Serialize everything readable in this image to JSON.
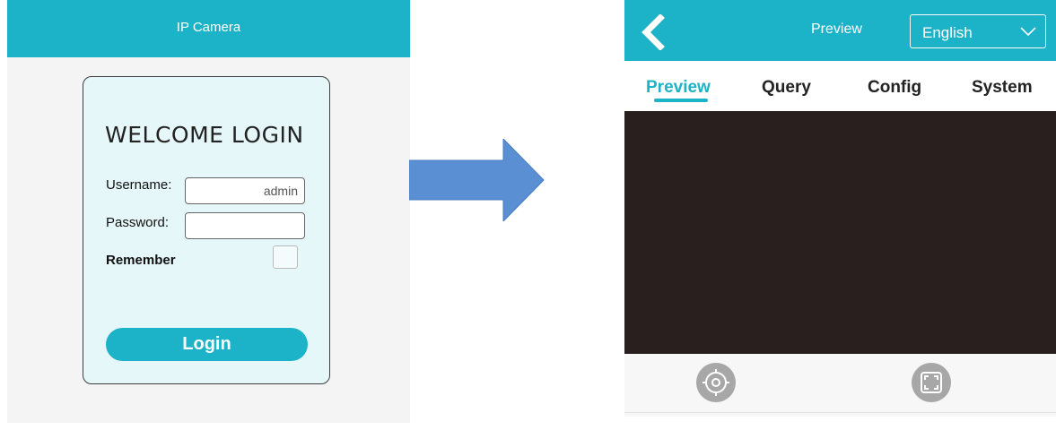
{
  "login": {
    "header_title": "IP Camera",
    "welcome_text": "WELCOME LOGIN",
    "username_label": "Username:",
    "username_value": "admin",
    "password_label": "Password:",
    "password_value": "",
    "remember_label": "Remember",
    "remember_checked": false,
    "login_button": "Login"
  },
  "arrow": {
    "icon": "right-arrow-icon",
    "color": "#5b8fd4"
  },
  "preview": {
    "header_title": "Preview",
    "back_icon": "chevron-left-icon",
    "language_selected": "English",
    "tabs": [
      {
        "label": "Preview",
        "active": true
      },
      {
        "label": "Query",
        "active": false
      },
      {
        "label": "Config",
        "active": false
      },
      {
        "label": "System",
        "active": false
      }
    ],
    "controls": [
      {
        "icon": "crosshair-target-icon"
      },
      {
        "icon": "fullscreen-icon"
      }
    ]
  },
  "colors": {
    "accent": "#1cb3c8",
    "card_background": "#e6f7f9",
    "video_background": "#2a1f1f",
    "control_button": "#a7a7a7"
  }
}
